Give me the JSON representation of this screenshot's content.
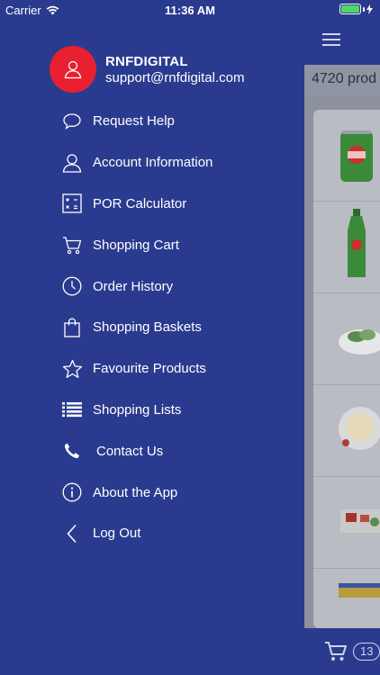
{
  "status": {
    "carrier": "Carrier",
    "time": "11:36 AM"
  },
  "profile": {
    "name": "RNFDIGITAL",
    "email": "support@rnfdigital.com"
  },
  "menu": [
    {
      "label": "Request Help",
      "icon": "chat-bubble-icon"
    },
    {
      "label": "Account Information",
      "icon": "user-icon"
    },
    {
      "label": "POR Calculator",
      "icon": "calculator-icon"
    },
    {
      "label": "Shopping Cart",
      "icon": "cart-icon"
    },
    {
      "label": "Order History",
      "icon": "clock-icon"
    },
    {
      "label": "Shopping Baskets",
      "icon": "bag-icon"
    },
    {
      "label": "Favourite Products",
      "icon": "star-icon"
    },
    {
      "label": "Shopping Lists",
      "icon": "list-icon"
    },
    {
      "label": "Contact Us",
      "icon": "phone-icon"
    },
    {
      "label": "About the App",
      "icon": "info-icon"
    },
    {
      "label": "Log Out",
      "icon": "chevron-left-icon"
    }
  ],
  "main": {
    "product_count": "4720 prod",
    "cart_count": "13"
  },
  "colors": {
    "drawer_bg": "#2a3b8f",
    "avatar_bg": "#e8202f",
    "battery": "#4cd964"
  }
}
